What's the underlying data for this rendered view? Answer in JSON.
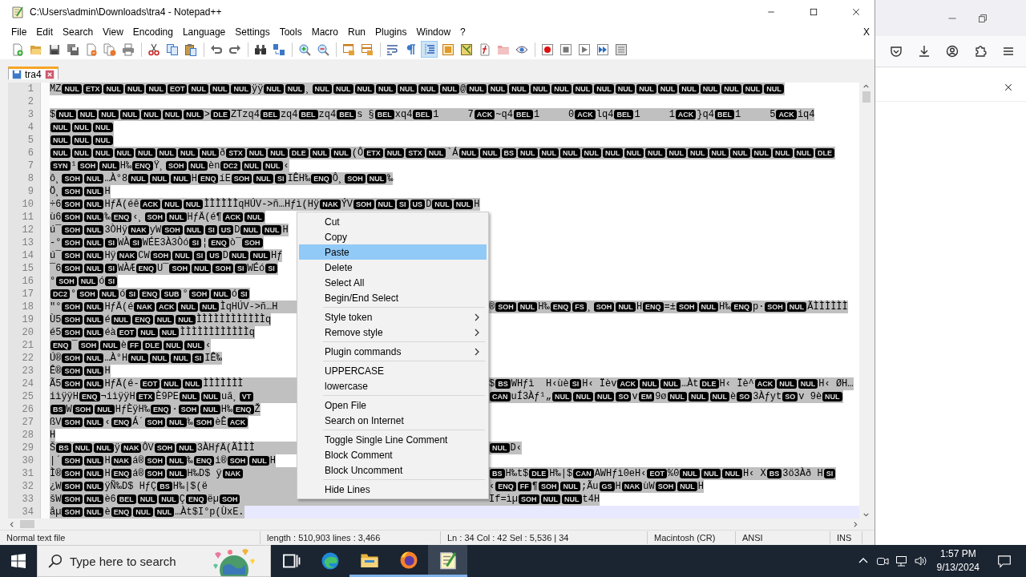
{
  "window": {
    "title": "C:\\Users\\admin\\Downloads\\tra4 - Notepad++"
  },
  "menu_bar": [
    "File",
    "Edit",
    "Search",
    "View",
    "Encoding",
    "Language",
    "Settings",
    "Tools",
    "Macro",
    "Run",
    "Plugins",
    "Window",
    "?"
  ],
  "close_document": "X",
  "toolbar": [
    {
      "kind": "new",
      "on": false
    },
    {
      "kind": "open",
      "on": false
    },
    {
      "kind": "save",
      "on": false
    },
    {
      "kind": "save_all",
      "on": false
    },
    {
      "kind": "close",
      "on": false
    },
    {
      "kind": "close_all",
      "on": false
    },
    {
      "kind": "print",
      "on": false
    },
    {
      "kind": "separator"
    },
    {
      "kind": "cut",
      "on": false
    },
    {
      "kind": "copy",
      "on": false
    },
    {
      "kind": "paste",
      "on": false
    },
    {
      "kind": "separator"
    },
    {
      "kind": "undo",
      "on": false
    },
    {
      "kind": "redo",
      "on": false
    },
    {
      "kind": "separator"
    },
    {
      "kind": "find",
      "on": false
    },
    {
      "kind": "replace",
      "on": false
    },
    {
      "kind": "separator"
    },
    {
      "kind": "zoom_in",
      "on": false
    },
    {
      "kind": "zoom_out",
      "on": false
    },
    {
      "kind": "separator"
    },
    {
      "kind": "sync_v",
      "on": false
    },
    {
      "kind": "sync_h",
      "on": false
    },
    {
      "kind": "separator"
    },
    {
      "kind": "wrap",
      "on": false
    },
    {
      "kind": "all_chars",
      "on": false
    },
    {
      "kind": "indent",
      "on": true
    },
    {
      "kind": "udl",
      "on": false
    },
    {
      "kind": "doc_map",
      "on": false
    },
    {
      "kind": "func_list",
      "on": false
    },
    {
      "kind": "folder_ws",
      "on": false
    },
    {
      "kind": "monitor",
      "on": false
    },
    {
      "kind": "separator"
    },
    {
      "kind": "record",
      "on": false
    },
    {
      "kind": "stop",
      "on": false
    },
    {
      "kind": "play",
      "on": false
    },
    {
      "kind": "play_multi",
      "on": false
    },
    {
      "kind": "save_macro",
      "on": false
    }
  ],
  "tabs": [
    {
      "label": "tra4",
      "selected": true
    }
  ],
  "editor": {
    "lines": [
      {
        "number": "1",
        "selected": true,
        "left": [
          "MZ",
          [
            "NUL",
            "ETX",
            "NUL",
            "NUL",
            "NUL",
            "EOT",
            "NUL",
            "NUL",
            "NUL"
          ],
          "ÿÿ",
          [
            "NUL",
            "NUL"
          ],
          "¸",
          [
            "NUL",
            "NUL",
            "NUL",
            "NUL",
            "NUL",
            "NUL",
            "NUL"
          ],
          "@",
          [
            "NUL",
            "NUL",
            "NUL",
            "NUL",
            "NUL",
            "NUL",
            "NUL",
            "NUL",
            "NUL",
            "NUL",
            "NUL",
            "NUL",
            "NUL",
            "NUL",
            "NUL"
          ]
        ]
      },
      {
        "number": "2"
      },
      {
        "number": "3",
        "selected": true,
        "left": [
          "$",
          [
            "NUL",
            "NUL",
            "NUL",
            "NUL",
            "NUL",
            "NUL",
            "NUL"
          ],
          ">",
          [
            "DLE"
          ],
          "ZTzq4",
          [
            "BEL"
          ],
          "zq4",
          [
            "BEL"
          ],
          "zq4",
          [
            "BEL"
          ],
          "s §",
          [
            "BEL"
          ],
          "xq4",
          [
            "BEL"
          ],
          "1     7",
          [
            "ACK"
          ],
          "~q4",
          [
            "BEL"
          ],
          "1     0",
          [
            "ACK"
          ],
          "lq4",
          [
            "BEL"
          ],
          "1     1",
          [
            "ACK"
          ],
          "}q4",
          [
            "BEL"
          ],
          "1     5",
          [
            "ACK"
          ],
          "iq4"
        ]
      },
      {
        "number": "4",
        "selected": true,
        "left": [
          [
            "NUL",
            "NUL",
            "NUL"
          ]
        ]
      },
      {
        "number": "5",
        "selected": true,
        "left": [
          [
            "NUL",
            "NUL",
            "NUL"
          ]
        ]
      },
      {
        "number": "6",
        "selected": true,
        "left": [
          [
            "NUL",
            "NUL",
            "NUL",
            "NUL",
            "NUL",
            "NUL",
            "NUL",
            "NUL"
          ],
          "ð",
          [
            "STX",
            "NUL",
            "NUL",
            "DLE",
            "NUL",
            "NUL"
          ],
          "(Ô",
          [
            "ETX",
            "NUL",
            "STX",
            "NUL"
          ],
          "`Á",
          [
            "NUL",
            "NUL",
            "BS",
            "NUL",
            "NUL",
            "NUL",
            "NUL",
            "NUL",
            "NUL",
            "NUL",
            "NUL",
            "NUL",
            "NUL",
            "NUL",
            "NUL",
            "NUL",
            "NUL",
            "DLE"
          ]
        ]
      },
      {
        "number": "7",
        "selected": true,
        "left": [
          [
            "SYN"
          ],
          "¹",
          [
            "SOH",
            "NUL"
          ],
          "H‰",
          [
            "ENQ"
          ],
          "Ÿ¸",
          [
            "SOH",
            "NUL"
          ],
          "èn",
          [
            "DC2",
            "NUL",
            "NUL"
          ],
          "‹"
        ]
      },
      {
        "number": "8",
        "selected": true,
        "left": [
          "ô¸",
          [
            "SOH",
            "NUL"
          ],
          "…À°8",
          [
            "NUL",
            "NUL",
            "NUL"
          ],
          "H",
          [
            "ENQ"
          ],
          "íE",
          [
            "SOH",
            "NUL",
            "SI"
          ],
          "IÊH‰",
          [
            "ENQ"
          ],
          "Ô¸",
          [
            "SOH",
            "NUL"
          ],
          "‰"
        ]
      },
      {
        "number": "9",
        "selected": true,
        "left": [
          "Ö¸",
          [
            "SOH",
            "NUL"
          ],
          "H"
        ]
      },
      {
        "number": "10",
        "selected": true,
        "left": [
          "÷6",
          [
            "SOH",
            "NUL"
          ],
          "HƒÄ(éê",
          [
            "ACK",
            "NUL",
            "NUL"
          ],
          "ÌÌÌÌÌÌqHÚV->ñ…Hƒì(Hÿ",
          [
            "NAK"
          ],
          "ÝV",
          [
            "SOH",
            "NUL",
            "SI",
            "US"
          ],
          "D",
          [
            "NUL",
            "NUL"
          ],
          "H"
        ]
      },
      {
        "number": "11",
        "selected": true,
        "left": [
          "ù6",
          [
            "SOH",
            "NUL"
          ],
          "‰",
          [
            "ENQ"
          ],
          "‹¸",
          [
            "SOH",
            "NUL"
          ],
          "HƒÄ(é¶",
          [
            "ACK",
            "NUL"
          ]
        ]
      },
      {
        "number": "12",
        "selected": true,
        "left": [
          "ú¯",
          [
            "SOH",
            "NUL"
          ],
          "3ÒHÿ",
          [
            "NAK"
          ],
          "yW",
          [
            "SOH",
            "NUL",
            "SI",
            "US"
          ],
          "D",
          [
            "NUL",
            "NUL"
          ],
          "H"
        ]
      },
      {
        "number": "13",
        "selected": true,
        "left": [
          "-°",
          [
            "SOH",
            "NUL",
            "SI"
          ],
          "WÀ",
          [
            "SI"
          ],
          "WÉE3À3Òó",
          [
            "SI"
          ],
          "¦",
          [
            "ENQ"
          ],
          "ò¯",
          [
            "SOH"
          ]
        ]
      },
      {
        "number": "14",
        "selected": true,
        "left": [
          "ú¯",
          [
            "SOH",
            "NUL"
          ],
          "Hÿ",
          [
            "NAK"
          ],
          "CW",
          [
            "SOH",
            "NUL",
            "SI",
            "US"
          ],
          "D",
          [
            "NUL",
            "NUL"
          ],
          "Hƒ"
        ]
      },
      {
        "number": "15",
        "selected": true,
        "left": [
          "¯6",
          [
            "SOH",
            "NUL",
            "SI"
          ],
          "WÀÆ",
          [
            "ENQ"
          ],
          "U¯",
          [
            "SOH",
            "NUL",
            "SOH",
            "SI"
          ],
          "WÉó",
          [
            "SI"
          ]
        ]
      },
      {
        "number": "16",
        "selected": true,
        "left": [
          "°",
          [
            "SOH",
            "NUL"
          ],
          "ó",
          [
            "SI"
          ]
        ]
      },
      {
        "number": "17",
        "selected": true,
        "left": [
          [
            "DC2"
          ],
          "°",
          [
            "SOH",
            "NUL"
          ],
          "ó",
          [
            "SI",
            "ENQ",
            "SUB"
          ],
          "°",
          [
            "SOH",
            "NUL"
          ],
          "ó",
          [
            "SI"
          ]
        ]
      },
      {
        "number": "18",
        "selected": true,
        "left": [
          "\"°",
          [
            "SOH",
            "NUL"
          ],
          "HƒÄ(é",
          [
            "NAK",
            "ACK",
            "NUL",
            "NUL"
          ],
          "ÌqHÚV->ñ…H"
        ],
        "right": [
          "®",
          [
            "SOH",
            "NUL"
          ],
          "H‰",
          [
            "ENQ",
            "FS"
          ],
          "¸",
          [
            "SOH",
            "NUL"
          ],
          "H",
          [
            "ENQ"
          ],
          "=±",
          [
            "SOH",
            "NUL"
          ],
          "H‰",
          [
            "ENQ"
          ],
          "p·",
          [
            "SOH",
            "NUL"
          ],
          "ÃÌÌÌÌÌÌ"
        ]
      },
      {
        "number": "19",
        "selected": true,
        "left": [
          "Ù5",
          [
            "SOH",
            "NUL"
          ],
          "é",
          [
            "NUL",
            "ENQ",
            "NUL",
            "NUL"
          ],
          "ÌÌÌÌÌÌÌÌÌÌÌÌq"
        ]
      },
      {
        "number": "20",
        "selected": true,
        "left": [
          "é5",
          [
            "SOH",
            "NUL"
          ],
          "éà",
          [
            "EOT",
            "NUL",
            "NUL"
          ],
          "ÌÌÌÌÌÌÌÌÌÌÌÌq"
        ]
      },
      {
        "number": "21",
        "selected": true,
        "left": [
          [
            "ENQ"
          ],
          "¯",
          [
            "SOH",
            "NUL"
          ],
          "è",
          [
            "FF",
            "DLE",
            "NUL",
            "NUL"
          ],
          "‹"
        ]
      },
      {
        "number": "22",
        "selected": true,
        "left": [
          "Ú®",
          [
            "SOH",
            "NUL"
          ],
          "…À°H",
          [
            "NUL",
            "NUL",
            "NUL",
            "SI"
          ],
          "IÊ‰"
        ]
      },
      {
        "number": "23",
        "selected": true,
        "left": [
          "Ê®",
          [
            "SOH",
            "NUL"
          ],
          "H"
        ]
      },
      {
        "number": "24",
        "selected": true,
        "left": [
          "Ã5",
          [
            "SOH",
            "NUL"
          ],
          "HƒÄ(é-",
          [
            "EOT",
            "NUL",
            "NUL"
          ],
          "ÌÌÌÌÌÌÌ"
        ],
        "right": [
          "$",
          [
            "BS"
          ],
          "WHƒì  H‹ùè",
          [
            "SI"
          ],
          "H‹ Ïèv",
          [
            "ACK",
            "NUL",
            "NUL"
          ],
          "…Àt",
          [
            "DLE"
          ],
          "H‹ Ïè^",
          [
            "ACK",
            "NUL",
            "NUL"
          ],
          "H‹ ØH…"
        ]
      },
      {
        "number": "25",
        "selected": true,
        "left": [
          "iìÿÿH",
          [
            "ENQ"
          ],
          "¬iìÿÿH",
          [
            "ETX"
          ],
          "È9PE",
          [
            "NUL",
            "NUL"
          ],
          "uã¸",
          [
            "VT"
          ]
        ],
        "right": [
          [
            "CAN"
          ],
          "uÍ3Àƒ¹„",
          [
            "NUL",
            "NUL",
            "NUL",
            "SO"
          ],
          "v",
          [
            "EM"
          ],
          "9ø",
          [
            "NUL",
            "NUL",
            "NUL"
          ],
          "è",
          [
            "SO"
          ],
          "3Àƒyt",
          [
            "SO"
          ],
          "v 9è",
          [
            "NUL"
          ]
        ]
      },
      {
        "number": "26",
        "selected": true,
        "left": [
          [
            "BS"
          ],
          "W",
          [
            "SOH",
            "NUL"
          ],
          "HƒÈÿH‰",
          [
            "ENQ"
          ],
          "·",
          [
            "SOH",
            "NUL"
          ],
          "H‰",
          [
            "ENQ"
          ],
          "Ž"
        ]
      },
      {
        "number": "27",
        "selected": true,
        "left": [
          "ßV",
          [
            "SOH",
            "NUL"
          ],
          "‹",
          [
            "ENQ"
          ],
          "Á´",
          [
            "SOH",
            "NUL"
          ],
          "‰",
          [
            "SOH"
          ],
          "èÊ",
          [
            "ACK"
          ]
        ]
      },
      {
        "number": "28",
        "selected": true,
        "left": [
          "H"
        ]
      },
      {
        "number": "29",
        "selected": true,
        "left": [
          "Š",
          [
            "BS",
            "NUL",
            "NUL"
          ],
          "ÿ",
          [
            "NAK"
          ],
          "ÔV",
          [
            "SOH",
            "NUL"
          ],
          "3ÀHƒÄ(ÃÌÌÌ"
        ],
        "right": [
          [
            "NUL"
          ],
          "D‹"
        ]
      },
      {
        "number": "30",
        "selected": true,
        "left": [
          "|´",
          [
            "SOH",
            "NUL"
          ],
          "H",
          [
            "NAK"
          ],
          "á®",
          [
            "SOH",
            "NUL"
          ],
          "‰",
          [
            "ENQ"
          ],
          "i®",
          [
            "SOH",
            "NUL"
          ],
          "H"
        ]
      },
      {
        "number": "31",
        "selected": true,
        "left": [
          "Ì®",
          [
            "SOH",
            "NUL"
          ],
          "H",
          [
            "ENQ"
          ],
          "á®",
          [
            "SOH",
            "NUL"
          ],
          "H‰D$ ÿ",
          [
            "NAK"
          ]
        ],
        "right": [
          [
            "BS"
          ],
          "H‰t$",
          [
            "DLE"
          ],
          "H‰|$",
          [
            "CAN"
          ],
          "AWHƒì0eH‹",
          [
            "EOT"
          ],
          "%0",
          [
            "NUL",
            "NUL",
            "NUL"
          ],
          "H‹ X",
          [
            "BS"
          ],
          "3ö3Àð H",
          [
            "SI"
          ]
        ]
      },
      {
        "number": "32",
        "selected": true,
        "left": [
          "¿W",
          [
            "SOH",
            "NUL"
          ],
          "ÿÑ‰D$ HƒÇ",
          [
            "BS"
          ],
          "H‰|$(ë"
        ],
        "right": [
          "‹",
          [
            "ENQ",
            "FF"
          ],
          "¶",
          [
            "SOH",
            "NUL"
          ],
          ";Ãu",
          [
            "GS"
          ],
          "H",
          [
            "NAK"
          ],
          "ùW",
          [
            "SOH",
            "NUL"
          ],
          "H"
        ]
      },
      {
        "number": "33",
        "selected": true,
        "left": [
          "šW",
          [
            "SOH",
            "NUL"
          ],
          "è6",
          [
            "BEL",
            "NUL",
            "NUL"
          ],
          "Ç",
          [
            "ENQ"
          ],
          "ëµ",
          [
            "SOH"
          ]
        ],
        "right": [
          "If=ìµ",
          [
            "SOH",
            "NUL",
            "NUL"
          ],
          "t4H"
        ]
      },
      {
        "number": "34",
        "selected": true,
        "current": true,
        "left": [
          "åµ",
          [
            "SOH",
            "NUL"
          ],
          "è",
          [
            "ENQ",
            "NUL",
            "NUL"
          ],
          "…Àt$I°p(ÙxE."
        ]
      }
    ]
  },
  "context_menu": {
    "items": [
      {
        "kind": "item",
        "label": "Cut",
        "selected": false,
        "submenu": false
      },
      {
        "kind": "item",
        "label": "Copy",
        "selected": false,
        "submenu": false
      },
      {
        "kind": "item",
        "label": "Paste",
        "selected": true,
        "submenu": false
      },
      {
        "kind": "item",
        "label": "Delete",
        "selected": false,
        "submenu": false
      },
      {
        "kind": "item",
        "label": "Select All",
        "selected": false,
        "submenu": false
      },
      {
        "kind": "item",
        "label": "Begin/End Select",
        "selected": false,
        "submenu": false
      },
      {
        "kind": "separator"
      },
      {
        "kind": "item",
        "label": "Style token",
        "selected": false,
        "submenu": true
      },
      {
        "kind": "item",
        "label": "Remove style",
        "selected": false,
        "submenu": true
      },
      {
        "kind": "separator"
      },
      {
        "kind": "item",
        "label": "Plugin commands",
        "selected": false,
        "submenu": true
      },
      {
        "kind": "separator"
      },
      {
        "kind": "item",
        "label": "UPPERCASE",
        "selected": false,
        "submenu": false
      },
      {
        "kind": "item",
        "label": "lowercase",
        "selected": false,
        "submenu": false
      },
      {
        "kind": "separator"
      },
      {
        "kind": "item",
        "label": "Open File",
        "selected": false,
        "submenu": false
      },
      {
        "kind": "item",
        "label": "Search on Internet",
        "selected": false,
        "submenu": false
      },
      {
        "kind": "separator"
      },
      {
        "kind": "item",
        "label": "Toggle Single Line Comment",
        "selected": false,
        "submenu": false
      },
      {
        "kind": "item",
        "label": "Block Comment",
        "selected": false,
        "submenu": false
      },
      {
        "kind": "item",
        "label": "Block Uncomment",
        "selected": false,
        "submenu": false
      },
      {
        "kind": "separator"
      },
      {
        "kind": "item",
        "label": "Hide Lines",
        "selected": false,
        "submenu": false
      }
    ]
  },
  "status_bar": [
    "Normal text file",
    "length : 510,903    lines : 3,466",
    "Ln : 34    Col : 42    Sel : 5,536 | 34",
    "Macintosh (CR)",
    "ANSI",
    "INS"
  ],
  "taskbar": {
    "search": {
      "placeholder": "Type here to search"
    },
    "apps": [
      {
        "kind": "task_view",
        "running": false,
        "active": false
      },
      {
        "kind": "edge",
        "running": false,
        "active": false
      },
      {
        "kind": "explorer",
        "running": true,
        "active": false
      },
      {
        "kind": "firefox",
        "running": true,
        "active": false
      },
      {
        "kind": "notepad",
        "running": true,
        "active": true
      }
    ],
    "time": "1:57 PM",
    "date": "9/13/2024"
  }
}
